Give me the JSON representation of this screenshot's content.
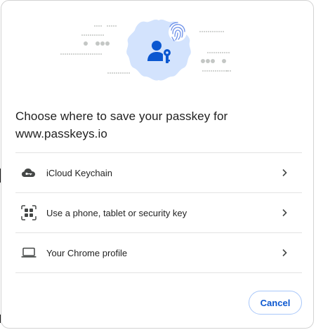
{
  "dialog": {
    "title": "Choose where to save your passkey for www.passkeys.io",
    "options": [
      {
        "label": "iCloud Keychain",
        "icon": "cloud-key-icon"
      },
      {
        "label": "Use a phone, tablet or security key",
        "icon": "qr-code-icon"
      },
      {
        "label": "Your Chrome profile",
        "icon": "laptop-icon"
      }
    ],
    "cancel_label": "Cancel"
  },
  "colors": {
    "accent": "#0b57d0",
    "hero_badge": "#d3e3fd",
    "hero_icon": "#0b57d0",
    "divider": "#e3e3e3"
  }
}
